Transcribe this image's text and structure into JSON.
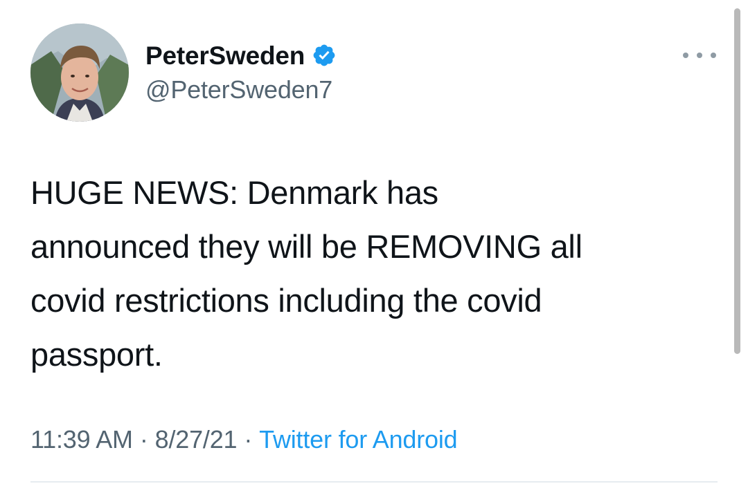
{
  "author": {
    "display_name": "PeterSweden",
    "handle": "@PeterSweden7",
    "verified": true,
    "verified_color": "#1d9bf0"
  },
  "tweet": {
    "text": "HUGE NEWS: Denmark has\nannounced they will be REMOVING all\ncovid restrictions including the covid\npassport.",
    "time": "11:39 AM",
    "date": "8/27/21",
    "source": "Twitter for Android",
    "separator": "·"
  },
  "icons": {
    "more": "more-horizontal-icon",
    "verified": "verified-badge-icon",
    "avatar": "avatar"
  },
  "colors": {
    "link": "#1d9bf0",
    "secondary_text": "#536471",
    "primary_text": "#0f1419"
  }
}
